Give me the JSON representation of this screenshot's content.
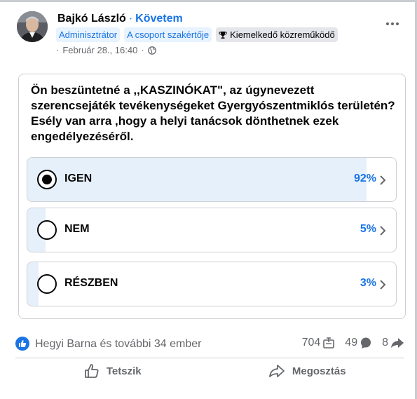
{
  "post": {
    "author": "Bajkó László",
    "separator": "·",
    "follow_label": "Követem",
    "badges": [
      "Adminisztrátor",
      "A csoport szakértője",
      "Kiemelkedő közreműködő"
    ],
    "timestamp": "Február 28., 16:40",
    "meta_dot": "·",
    "privacy_icon": "globe-icon"
  },
  "poll": {
    "question": "Ön beszüntetné a ,,KASZINÓKAT\", az úgynevezett szerencsejáték tevékenységeket Gyergyószentmiklós területén? Esély van arra ,hogy a helyi tanácsok dönthetnek ezek engedélyezéséről.",
    "options": [
      {
        "label": "IGEN",
        "percent": "92%",
        "share": 0.92,
        "selected": true
      },
      {
        "label": "NEM",
        "percent": "5%",
        "share": 0.05,
        "selected": false
      },
      {
        "label": "RÉSZBEN",
        "percent": "3%",
        "share": 0.03,
        "selected": false
      }
    ]
  },
  "stats": {
    "reactors": "Hegyi Barna és további 34 ember",
    "votes": "704",
    "comments": "49",
    "shares": "8"
  },
  "actions": {
    "like": "Tetszik",
    "share": "Megosztás"
  },
  "colors": {
    "accent": "#1b74e4",
    "poll_fill": "#e6f0fb",
    "muted": "#65676b"
  }
}
